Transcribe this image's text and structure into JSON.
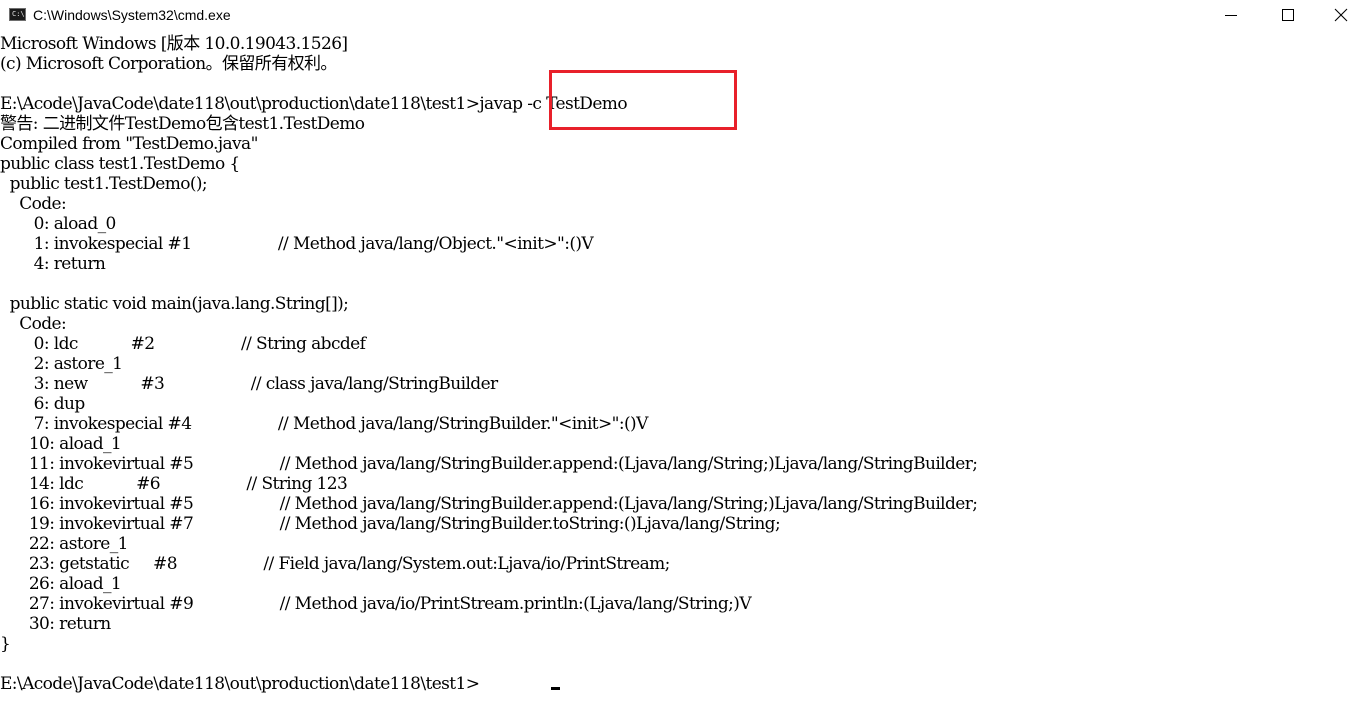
{
  "window": {
    "title": "C:\\Windows\\System32\\cmd.exe",
    "icon_label": "C:\\",
    "controls": {
      "minimize": "minimize-icon",
      "maximize": "maximize-icon",
      "close": "close-icon"
    }
  },
  "console": {
    "lines": [
      "Microsoft Windows [版本 10.0.19043.1526]",
      "(c) Microsoft Corporation。保留所有权利。",
      "",
      "E:\\Acode\\JavaCode\\date118\\out\\production\\date118\\test1>javap -c TestDemo",
      "警告: 二进制文件TestDemo包含test1.TestDemo",
      "Compiled from \"TestDemo.java\"",
      "public class test1.TestDemo {",
      "  public test1.TestDemo();",
      "    Code:",
      "       0: aload_0",
      "       1: invokespecial #1                  // Method java/lang/Object.\"<init>\":()V",
      "       4: return",
      "",
      "  public static void main(java.lang.String[]);",
      "    Code:",
      "       0: ldc           #2                  // String abcdef",
      "       2: astore_1",
      "       3: new           #3                  // class java/lang/StringBuilder",
      "       6: dup",
      "       7: invokespecial #4                  // Method java/lang/StringBuilder.\"<init>\":()V",
      "      10: aload_1",
      "      11: invokevirtual #5                  // Method java/lang/StringBuilder.append:(Ljava/lang/String;)Ljava/lang/StringBuilder;",
      "      14: ldc           #6                  // String 123",
      "      16: invokevirtual #5                  // Method java/lang/StringBuilder.append:(Ljava/lang/String;)Ljava/lang/StringBuilder;",
      "      19: invokevirtual #7                  // Method java/lang/StringBuilder.toString:()Ljava/lang/String;",
      "      22: astore_1",
      "      23: getstatic     #8                  // Field java/lang/System.out:Ljava/io/PrintStream;",
      "      26: aload_1",
      "      27: invokevirtual #9                  // Method java/io/PrintStream.println:(Ljava/lang/String;)V",
      "      30: return",
      "}",
      "",
      "E:\\Acode\\JavaCode\\date118\\out\\production\\date118\\test1>"
    ]
  },
  "annotation": {
    "color": "#e8202a"
  },
  "colors": {
    "background": "#ffffff",
    "text": "#000000"
  }
}
